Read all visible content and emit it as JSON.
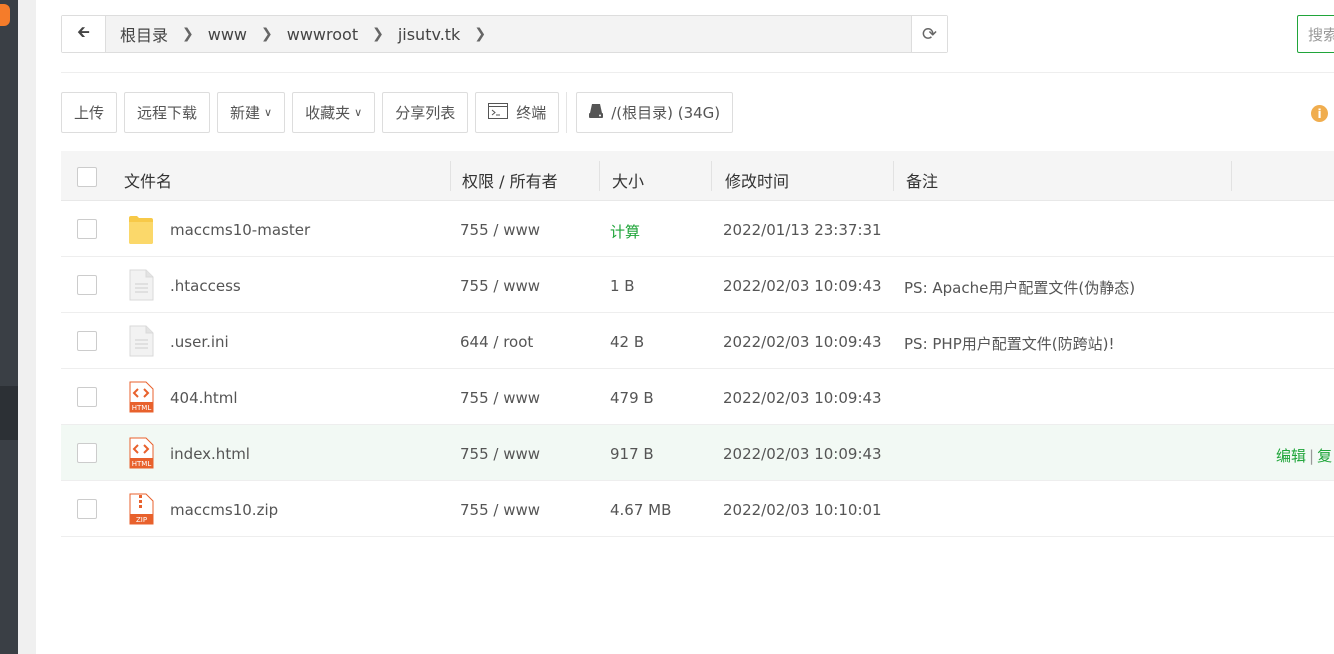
{
  "breadcrumb": {
    "items": [
      "根目录",
      "www",
      "wwwroot",
      "jisutv.tk"
    ]
  },
  "search": {
    "placeholder": "搜索"
  },
  "toolbar": {
    "upload": "上传",
    "remote_download": "远程下载",
    "new": "新建",
    "favorites": "收藏夹",
    "share_list": "分享列表",
    "terminal": "终端",
    "disk": "/(根目录) (34G)"
  },
  "table": {
    "headers": {
      "name": "文件名",
      "permission": "权限 / 所有者",
      "size": "大小",
      "mtime": "修改时间",
      "remark": "备注"
    },
    "rows": [
      {
        "name": "maccms10-master",
        "perm": "755 / www",
        "size": "计算",
        "mtime": "2022/01/13 23:37:31",
        "remark": "",
        "type": "folder"
      },
      {
        "name": ".htaccess",
        "perm": "755 / www",
        "size": "1 B",
        "mtime": "2022/02/03 10:09:43",
        "remark": "PS: Apache用户配置文件(伪静态)",
        "type": "file"
      },
      {
        "name": ".user.ini",
        "perm": "644 / root",
        "size": "42 B",
        "mtime": "2022/02/03 10:09:43",
        "remark": "PS: PHP用户配置文件(防跨站)!",
        "type": "file"
      },
      {
        "name": "404.html",
        "perm": "755 / www",
        "size": "479 B",
        "mtime": "2022/02/03 10:09:43",
        "remark": "",
        "type": "html"
      },
      {
        "name": "index.html",
        "perm": "755 / www",
        "size": "917 B",
        "mtime": "2022/02/03 10:09:43",
        "remark": "",
        "type": "html",
        "ops": [
          "编辑",
          "复"
        ]
      },
      {
        "name": "maccms10.zip",
        "perm": "755 / www",
        "size": "4.67 MB",
        "mtime": "2022/02/03 10:10:01",
        "remark": "",
        "type": "zip"
      }
    ]
  },
  "icons": {
    "html_label": "HTML",
    "zip_label": "ZIP"
  },
  "colors": {
    "accent": "#20a53a",
    "sidebar": "#3a3f45",
    "warning": "#f0ad4e",
    "html_icon": "#e8612c"
  }
}
